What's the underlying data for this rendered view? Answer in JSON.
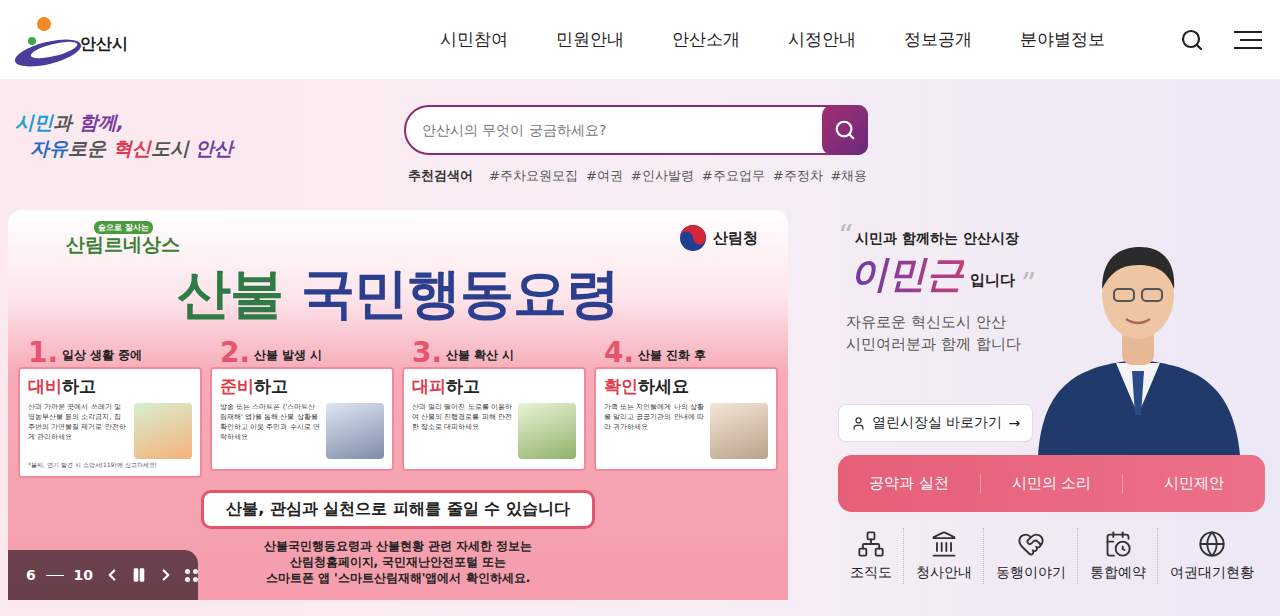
{
  "header": {
    "logo": "안산시",
    "nav": [
      "시민참여",
      "민원안내",
      "안산소개",
      "시정안내",
      "정보공개",
      "분야별정보"
    ]
  },
  "slogan": [
    [
      {
        "text": "시민",
        "color": "#1f9ad6"
      },
      {
        "text": "과 ",
        "color": "#555555"
      },
      {
        "text": "함께,",
        "color": "#7b3aa0"
      }
    ],
    [
      {
        "text": "자유",
        "color": "#2769c4"
      },
      {
        "text": "로운 ",
        "color": "#555555"
      },
      {
        "text": "혁신",
        "color": "#e0384f"
      },
      {
        "text": "도시 ",
        "color": "#555555"
      },
      {
        "text": "안산",
        "color": "#6c3ea6"
      }
    ]
  ],
  "search": {
    "placeholder": "안산시의 무엇이 궁금하세요?",
    "recommend_label": "추천검색어",
    "tags": [
      "#주차요원모집",
      "#여권",
      "#인사발령",
      "#주요업무",
      "#주정차",
      "#채용"
    ]
  },
  "banner": {
    "brand": "산림르네상스",
    "brand_tag": "숲으로 잘사는",
    "agency": "산림청",
    "title": [
      {
        "text": "산불 ",
        "color": "#2f7a45"
      },
      {
        "text": "국민행동요령",
        "color": "#2c3f8f"
      }
    ],
    "steps": [
      {
        "number": "1.",
        "when": "일상 생활 중에",
        "action": "대비",
        "action_rest": "하고",
        "text": "산과 가까운 곳에서 쓰레기 및 영농부산물 등의 소각금지, 집 주변의 가연물질 제거로 안전하게 관리하세요",
        "note": "*불씨, 연기 발견 시 소방서(119)에 신고하세요!"
      },
      {
        "number": "2.",
        "when": "산불 발생 시",
        "action": "준비",
        "action_rest": "하고",
        "text": "방송 또는 스마트폰 ('스마트산림재해' 앱)을 통해 산불 상황을 확인하고 이웃 주민과 수시로 연락하세요"
      },
      {
        "number": "3.",
        "when": "산불 확산 시",
        "action": "대피",
        "action_rest": "하고",
        "text": "산과 멀리 떨어진 도로를 이용하여 산불의 진행경로를 피해 안전한 장소로 대피하세요"
      },
      {
        "number": "4.",
        "when": "산불 진화 후",
        "action": "확인",
        "action_rest": "하세요",
        "text": "가족 또는 지인들에게 나의 상황을 알리고 공공기관의 안내에 따라 귀가하세요"
      }
    ],
    "tagline": "산불, 관심과 실천으로 피해를 줄일 수 있습니다",
    "info": [
      "산불국민행동요령과 산불현황 관련 자세한 정보는",
      "산림청홈페이지, 국민재난안전포털 또는",
      "스마트폰 앱 '스마트산림재해'앱에서 확인하세요."
    ],
    "pager": {
      "current": "6",
      "total": "10",
      "playing": true
    }
  },
  "mayor": {
    "quote_open": "“",
    "heading": "시민과 함께하는 안산시장",
    "name": "이민근",
    "name_suffix": "입니다",
    "quote_close": "”",
    "desc": [
      "자유로운 혁신도시 안산",
      "시민여러분과 함께 합니다"
    ],
    "button": "열린시장실 바로가기",
    "button_arrow": "→"
  },
  "quick_links": [
    "공약과 실천",
    "시민의 소리",
    "시민제안"
  ],
  "services": [
    "조직도",
    "청사안내",
    "동행이야기",
    "통합예약",
    "여권대기현황"
  ]
}
